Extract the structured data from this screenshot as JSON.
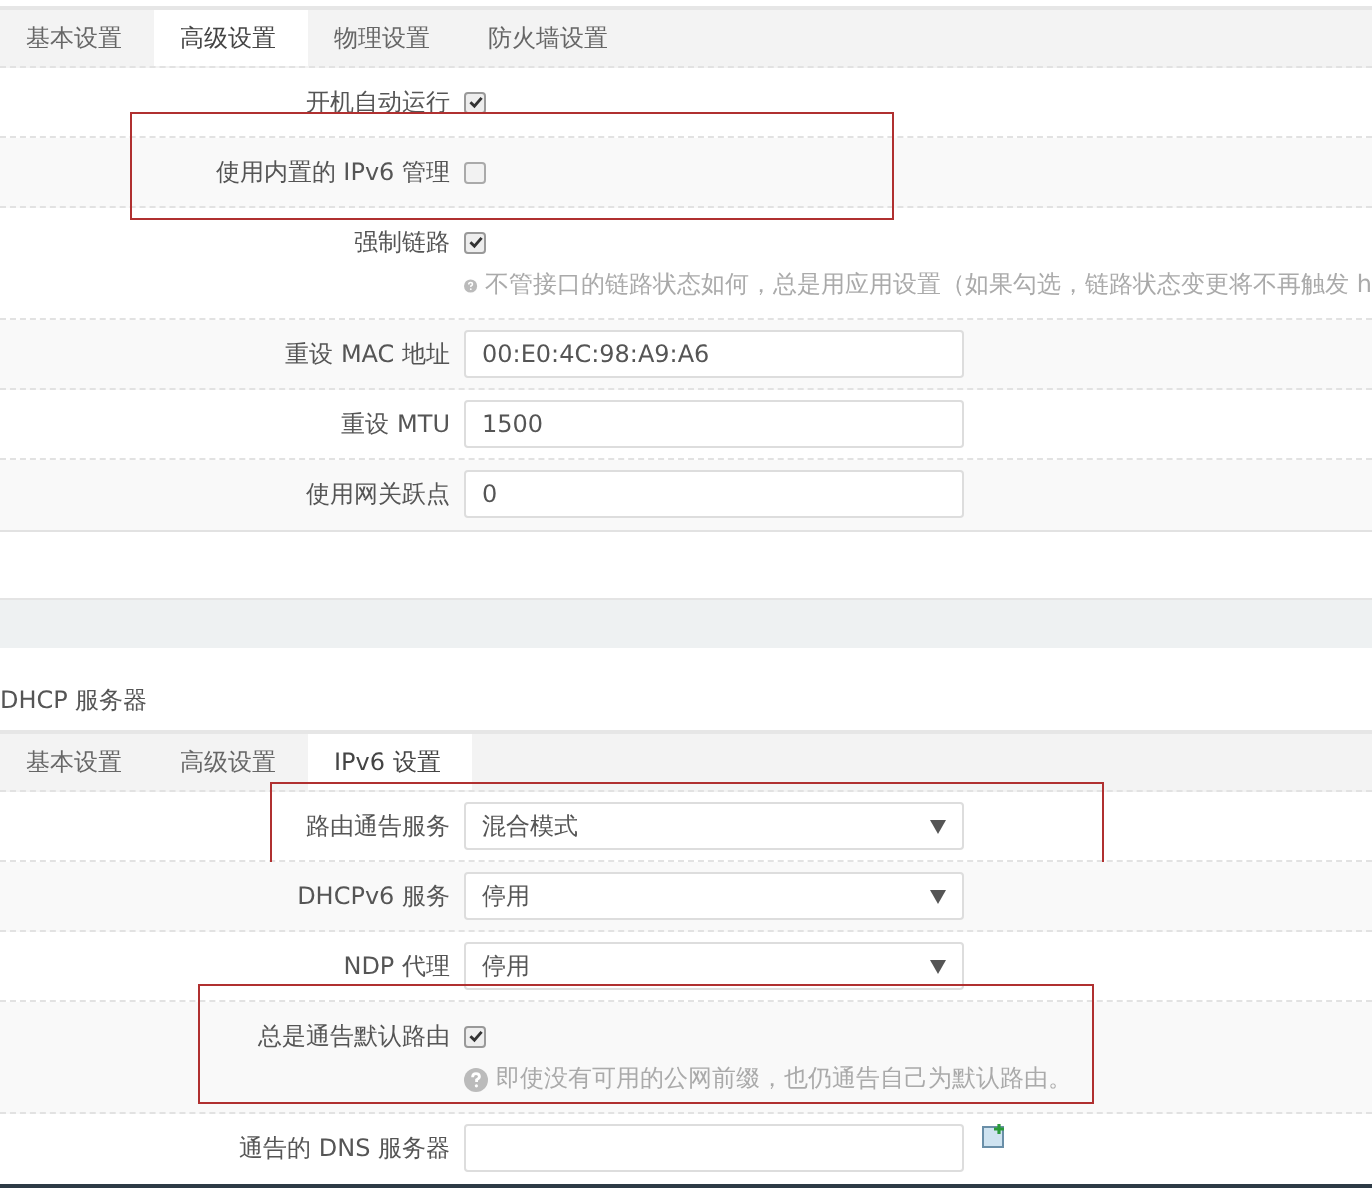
{
  "sections": [
    {
      "tabs": [
        {
          "label": "基本设置",
          "selected": false
        },
        {
          "label": "高级设置",
          "selected": true
        },
        {
          "label": "物理设置",
          "selected": false
        },
        {
          "label": "防火墙设置",
          "selected": false
        }
      ],
      "rows": [
        {
          "kind": "checkbox",
          "label": "开机自动运行",
          "checked": true,
          "highlighted": false
        },
        {
          "kind": "checkbox",
          "label": "使用内置的 IPv6 管理",
          "checked": false,
          "highlighted": true
        },
        {
          "kind": "checkbox",
          "label": "强制链路",
          "checked": true,
          "highlighted": false,
          "help": "不管接口的链路状态如何，总是用应用设置（如果勾选，链路状态变更将不再触发 h"
        },
        {
          "kind": "text",
          "label": "重设 MAC 地址",
          "value": "00:E0:4C:98:A9:A6",
          "highlighted": false
        },
        {
          "kind": "text",
          "label": "重设 MTU",
          "value": "1500",
          "highlighted": false
        },
        {
          "kind": "text",
          "label": "使用网关跃点",
          "value": "0",
          "highlighted": false
        }
      ]
    },
    {
      "title": "DHCP 服务器",
      "tabs": [
        {
          "label": "基本设置",
          "selected": false
        },
        {
          "label": "高级设置",
          "selected": false
        },
        {
          "label": "IPv6 设置",
          "selected": true
        }
      ],
      "rows": [
        {
          "kind": "select",
          "label": "路由通告服务",
          "value": "混合模式",
          "highlighted": true
        },
        {
          "kind": "select",
          "label": "DHCPv6 服务",
          "value": "停用",
          "highlighted": false
        },
        {
          "kind": "select",
          "label": "NDP 代理",
          "value": "停用",
          "highlighted": false
        },
        {
          "kind": "checkbox",
          "label": "总是通告默认路由",
          "checked": true,
          "highlighted": true,
          "help": "即使没有可用的公网前缀，也仍通告自己为默认路由。"
        },
        {
          "kind": "list",
          "label": "通告的 DNS 服务器",
          "value": "",
          "highlighted": false
        }
      ]
    }
  ]
}
